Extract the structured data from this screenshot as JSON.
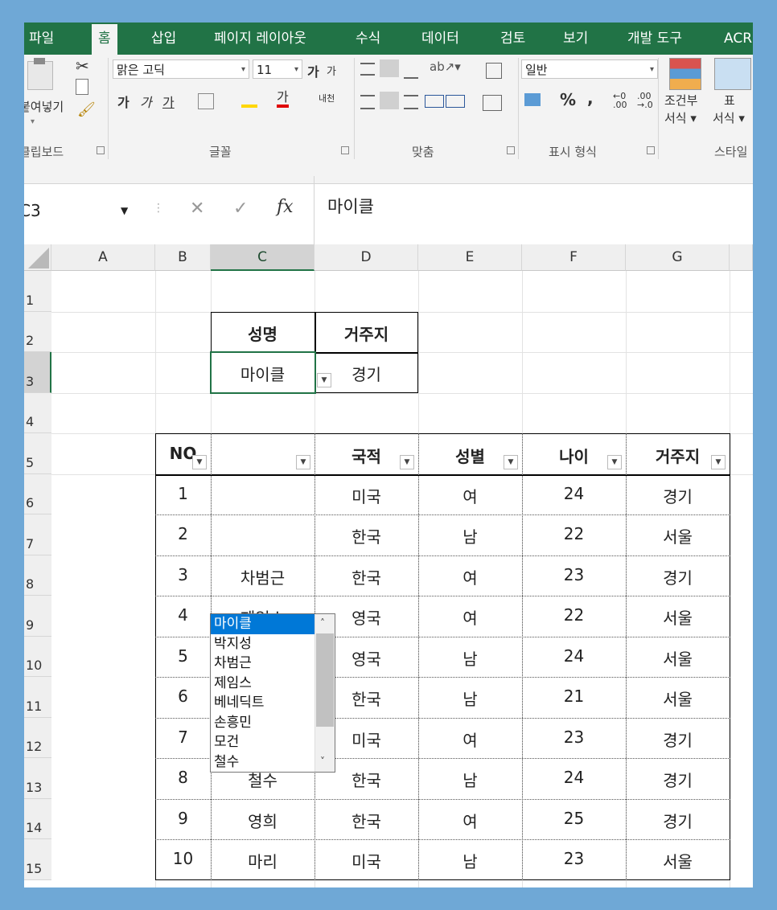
{
  "tabs": [
    "파일",
    "홈",
    "삽입",
    "페이지 레이아웃",
    "수식",
    "데이터",
    "검토",
    "보기",
    "개발 도구",
    "ACR"
  ],
  "ribbon": {
    "paste_label": "붙여넣기",
    "clipboard_group": "클립보드",
    "font_name": "맑은 고딕",
    "font_size": "11",
    "font_grow": "가",
    "font_shrink": "가",
    "bold": "가",
    "italic": "가",
    "underline": "가",
    "font_color_label": "가",
    "phonetic": "내천",
    "font_group": "글꼴",
    "align_group": "맞춤",
    "number_format": "일반",
    "percent": "%",
    "comma": ",",
    "number_group": "표시 형식",
    "cond_format_1": "조건부",
    "cond_format_2": "서식 ▾",
    "table_format_1": "표",
    "table_format_2": "서식 ▾",
    "style_group": "스타일"
  },
  "formula_bar": {
    "name_box": "C3",
    "fx": "fx",
    "formula": "마이클"
  },
  "columns": [
    "A",
    "B",
    "C",
    "D",
    "E",
    "F",
    "G"
  ],
  "rows": [
    "1",
    "2",
    "3",
    "4",
    "5",
    "6",
    "7",
    "8",
    "9",
    "10",
    "11",
    "12",
    "13",
    "14",
    "15"
  ],
  "lookup": {
    "h_name": "성명",
    "h_addr": "거주지",
    "name": "마이클",
    "addr": "경기"
  },
  "dropdown_items": [
    "마이클",
    "박지성",
    "차범근",
    "제임스",
    "베네딕트",
    "손흥민",
    "모건",
    "철수"
  ],
  "table": {
    "headers": [
      "NO",
      "국적",
      "성별",
      "나이",
      "거주지"
    ],
    "rows": [
      [
        "1",
        "",
        "미국",
        "여",
        "24",
        "경기"
      ],
      [
        "2",
        "",
        "한국",
        "남",
        "22",
        "서울"
      ],
      [
        "3",
        "차범근",
        "한국",
        "여",
        "23",
        "경기"
      ],
      [
        "4",
        "제임스",
        "영국",
        "여",
        "22",
        "서울"
      ],
      [
        "5",
        "베네딕트",
        "영국",
        "남",
        "24",
        "서울"
      ],
      [
        "6",
        "손흥민",
        "한국",
        "남",
        "21",
        "서울"
      ],
      [
        "7",
        "모건",
        "미국",
        "여",
        "23",
        "경기"
      ],
      [
        "8",
        "철수",
        "한국",
        "남",
        "24",
        "경기"
      ],
      [
        "9",
        "영희",
        "한국",
        "여",
        "25",
        "경기"
      ],
      [
        "10",
        "마리",
        "미국",
        "남",
        "23",
        "서울"
      ]
    ]
  }
}
